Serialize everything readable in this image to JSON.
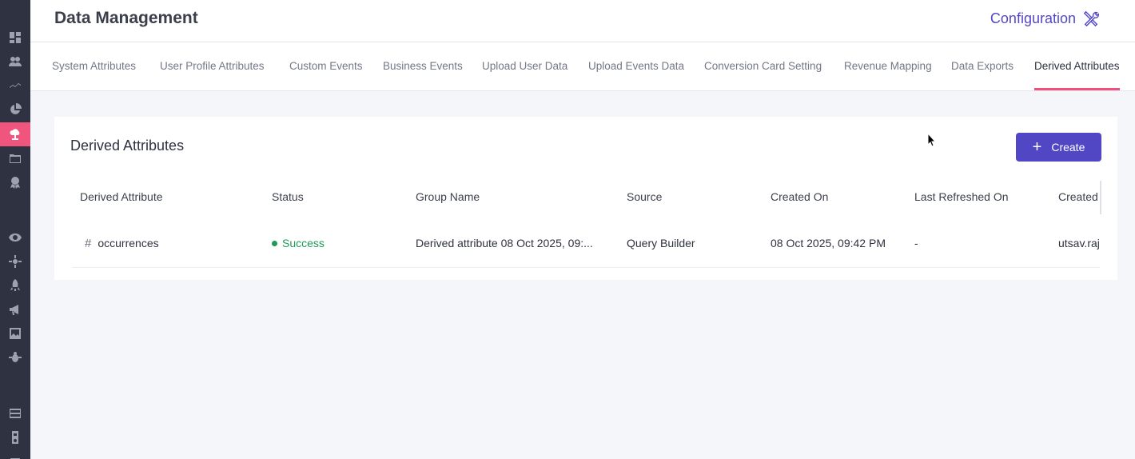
{
  "header": {
    "title": "Data Management",
    "config_label": "Configuration"
  },
  "sidebar": {
    "icons": [
      "dashboard-icon",
      "users-icon",
      "trend-icon",
      "pie-chart-icon",
      "data-cloud-icon",
      "folders-icon",
      "badge-icon",
      "eye-icon",
      "settings-sun-icon",
      "rocket-icon",
      "megaphone-icon",
      "image-icon",
      "bug-icon",
      "inbox-icon",
      "device-icon"
    ],
    "active": "data-cloud-icon"
  },
  "tabs": [
    "System Attributes",
    "User Profile Attributes",
    "Custom Events",
    "Business Events",
    "Upload User Data",
    "Upload Events Data",
    "Conversion Card Setting",
    "Revenue Mapping",
    "Data Exports",
    "Derived Attributes"
  ],
  "active_tab": "Derived Attributes",
  "card": {
    "title": "Derived Attributes",
    "create_label": "Create"
  },
  "table": {
    "columns": [
      "Derived Attribute",
      "Status",
      "Group Name",
      "Source",
      "Created On",
      "Last Refreshed On",
      "Created"
    ],
    "rows": [
      {
        "name": "occurrences",
        "status": "Success",
        "group": "Derived attribute 08 Oct 2025, 09:...",
        "source": "Query Builder",
        "created_on": "08 Oct 2025, 09:42 PM",
        "last_refreshed": "-",
        "created_by": "utsav.raj"
      }
    ]
  },
  "colors": {
    "accent": "#5147c5",
    "active_tab": "#ef4f7c",
    "sidebar": "#2f3240",
    "success": "#1f9a54"
  }
}
